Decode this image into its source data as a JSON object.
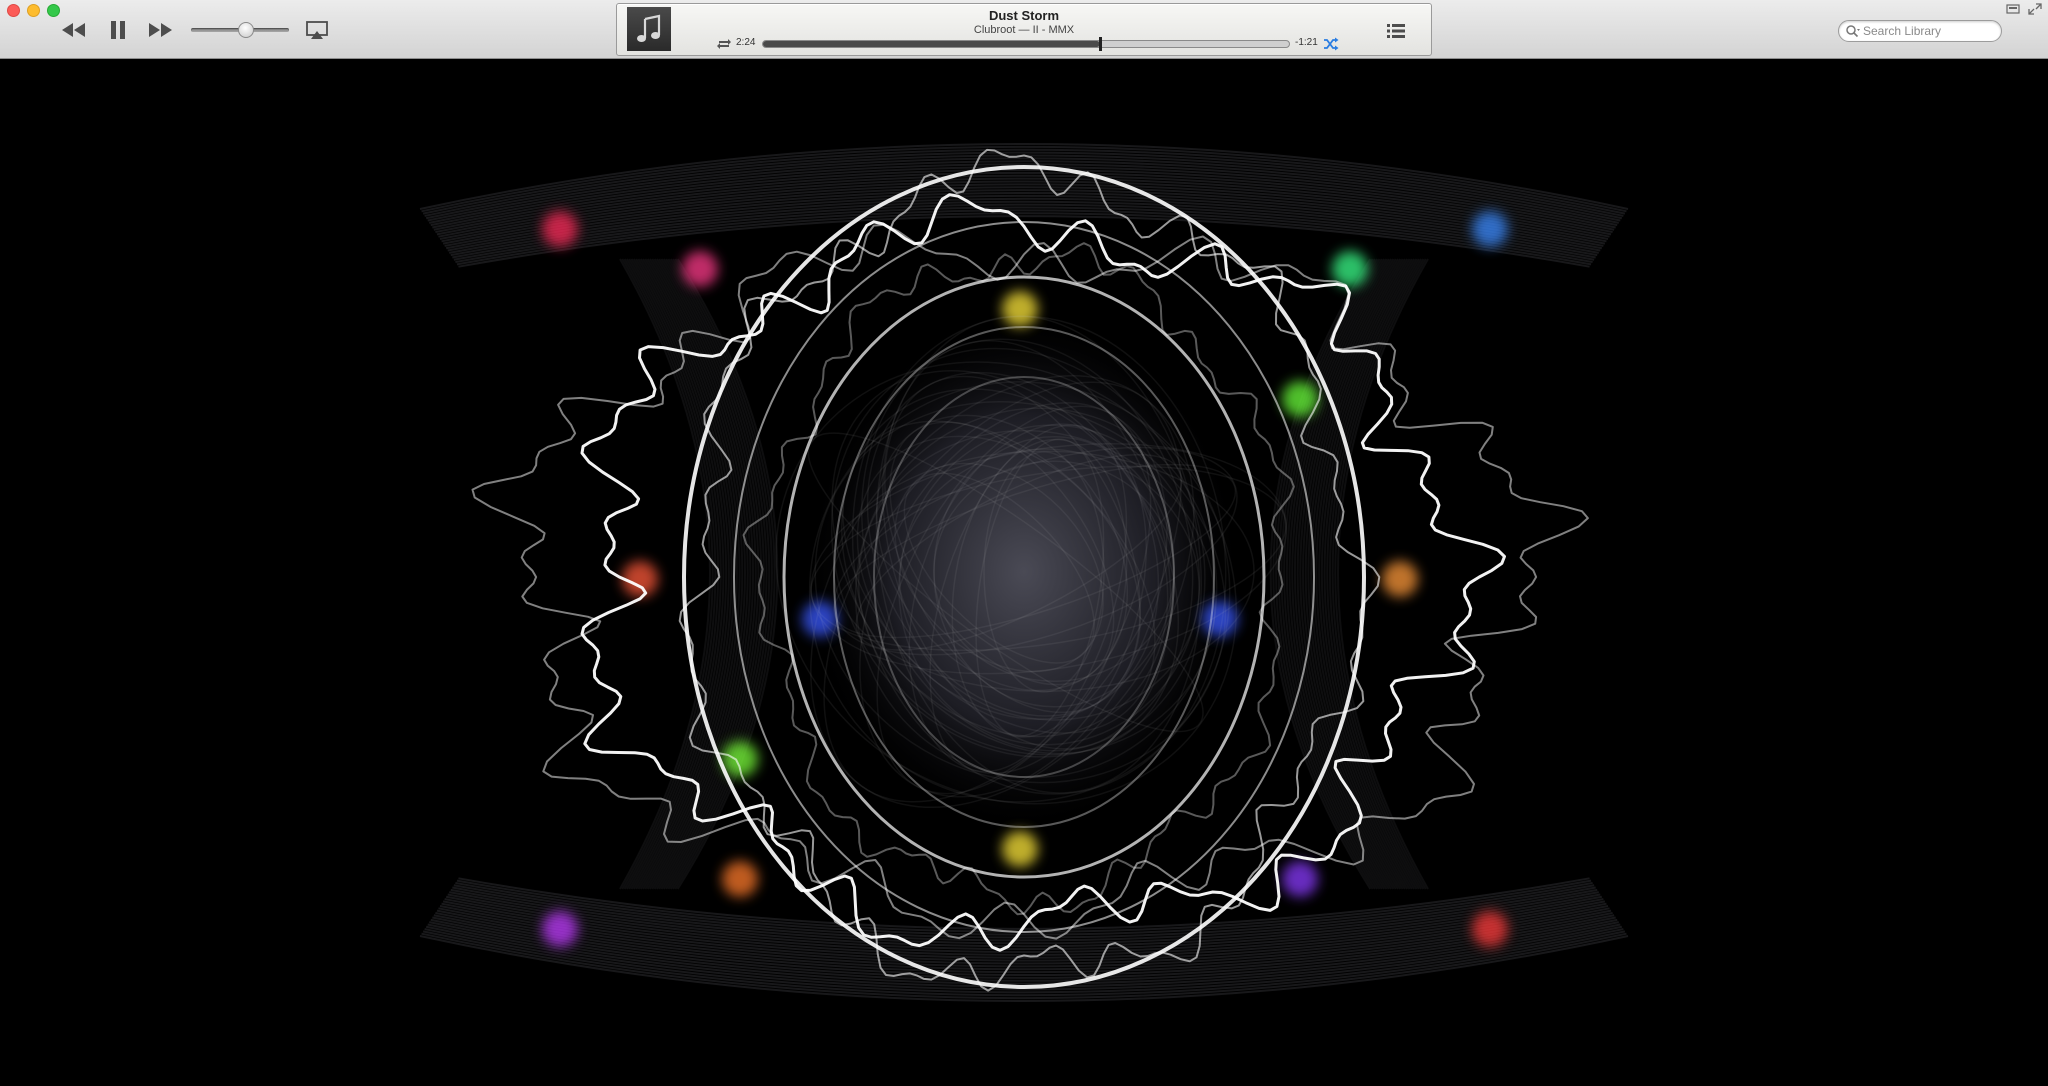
{
  "window": {
    "buttons": [
      "close",
      "minimize",
      "zoom"
    ]
  },
  "controls": {
    "rewind_icon": "rewind-icon",
    "pause_icon": "pause-icon",
    "forward_icon": "fast-forward-icon",
    "volume_level": 0.56,
    "airplay_icon": "airplay-icon"
  },
  "now_playing": {
    "title": "Dust Storm",
    "subtitle": "Clubroot — II - MMX",
    "elapsed": "2:24",
    "remaining": "-1:21",
    "progress": 0.64,
    "repeat_icon": "repeat-icon",
    "shuffle_icon": "shuffle-icon",
    "upnext_icon": "list-icon"
  },
  "search": {
    "placeholder": "Search Library",
    "value": ""
  },
  "colors": {
    "shuffle_active": "#2a7de1",
    "toolbar_top": "#ececec",
    "toolbar_bottom": "#d3d3d3",
    "background": "#000000"
  }
}
